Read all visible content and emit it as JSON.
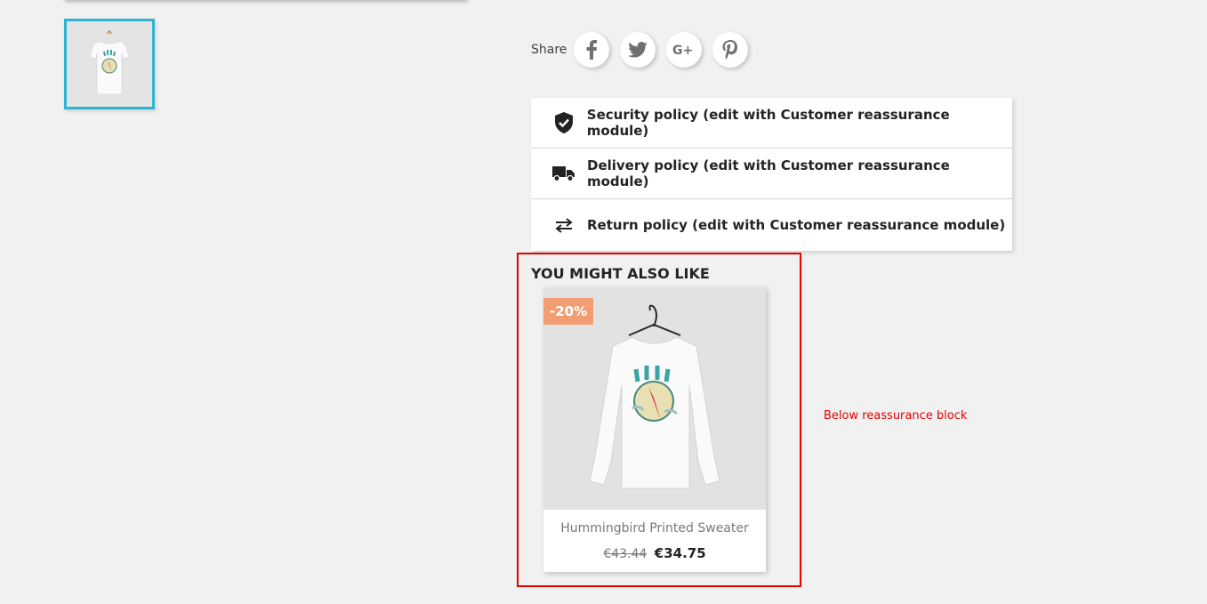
{
  "gallery": {
    "thumbnail_alt": "Hummingbird printed t-shirt thumbnail",
    "active_border_color": "#2fb5d2"
  },
  "share": {
    "label": "Share",
    "buttons": [
      {
        "name": "facebook",
        "icon": "facebook-icon"
      },
      {
        "name": "twitter",
        "icon": "twitter-icon"
      },
      {
        "name": "googleplus",
        "icon": "google-plus-icon"
      },
      {
        "name": "pinterest",
        "icon": "pinterest-icon"
      }
    ]
  },
  "reassurance": {
    "items": [
      {
        "icon": "shield-check-icon",
        "label": "Security policy (edit with Customer reassurance module)"
      },
      {
        "icon": "truck-icon",
        "label": "Delivery policy (edit with Customer reassurance module)"
      },
      {
        "icon": "swap-arrows-icon",
        "label": "Return policy (edit with Customer reassurance module)"
      }
    ]
  },
  "related": {
    "title": "YOU MIGHT ALSO LIKE",
    "products": [
      {
        "name": "Hummingbird Printed Sweater",
        "discount": "-20%",
        "regular_price": "€43.44",
        "price": "€34.75"
      }
    ]
  },
  "hook_note": "Below reassurance block",
  "colors": {
    "accent": "#2fb5d2",
    "discount_badge": "#f39d72",
    "highlight": "#e60000",
    "background": "#f1f1f1"
  }
}
